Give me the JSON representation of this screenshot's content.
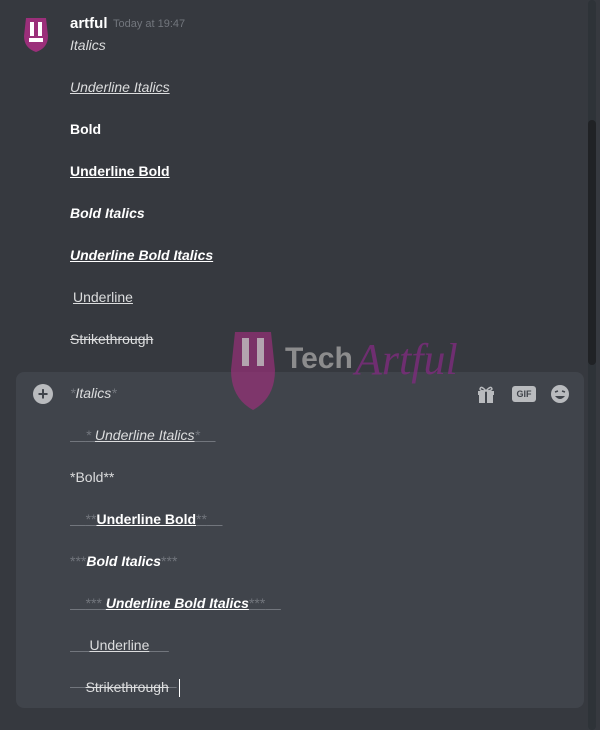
{
  "message": {
    "username": "artful",
    "timestamp": "Today at 19:47",
    "lines": [
      "Italics",
      "Underline Italics",
      "Bold",
      "Underline Bold",
      "Bold Italics",
      "Underline Bold Italics",
      "Underline",
      "Strikethrough"
    ]
  },
  "composer": {
    "plus_label": "+",
    "gif_label": "GIF",
    "lines": {
      "l1_mark_a": "*",
      "l1_text": "Italics",
      "l1_mark_b": "*",
      "l2_mark_a": "*",
      "l2_text": "Underline Italics",
      "l2_mark_b": "*",
      "l3_text": "*Bold**",
      "l4_mark_a": "**",
      "l4_text": "Underline Bold",
      "l4_mark_b": "**",
      "l5_mark_a": "***",
      "l5_text": "Bold Italics",
      "l5_mark_b": "***",
      "l6_mark_a": "***",
      "l6_text": "Underline Bold Italics",
      "l6_mark_b": "***",
      "l7_text": "Underline",
      "l8_text": "Strikethrough"
    }
  },
  "watermark": {
    "word1": "Tech",
    "word2": "Artful"
  },
  "colors": {
    "background": "#36393f",
    "composer": "#40444b",
    "text": "#dcddde",
    "muted": "#72767d",
    "brand": "#9b2f7a"
  },
  "icons": {
    "avatar": "tech-artful-logo",
    "plus": "plus-circle-icon",
    "gift": "gift-icon",
    "emoji": "emoji-icon"
  }
}
